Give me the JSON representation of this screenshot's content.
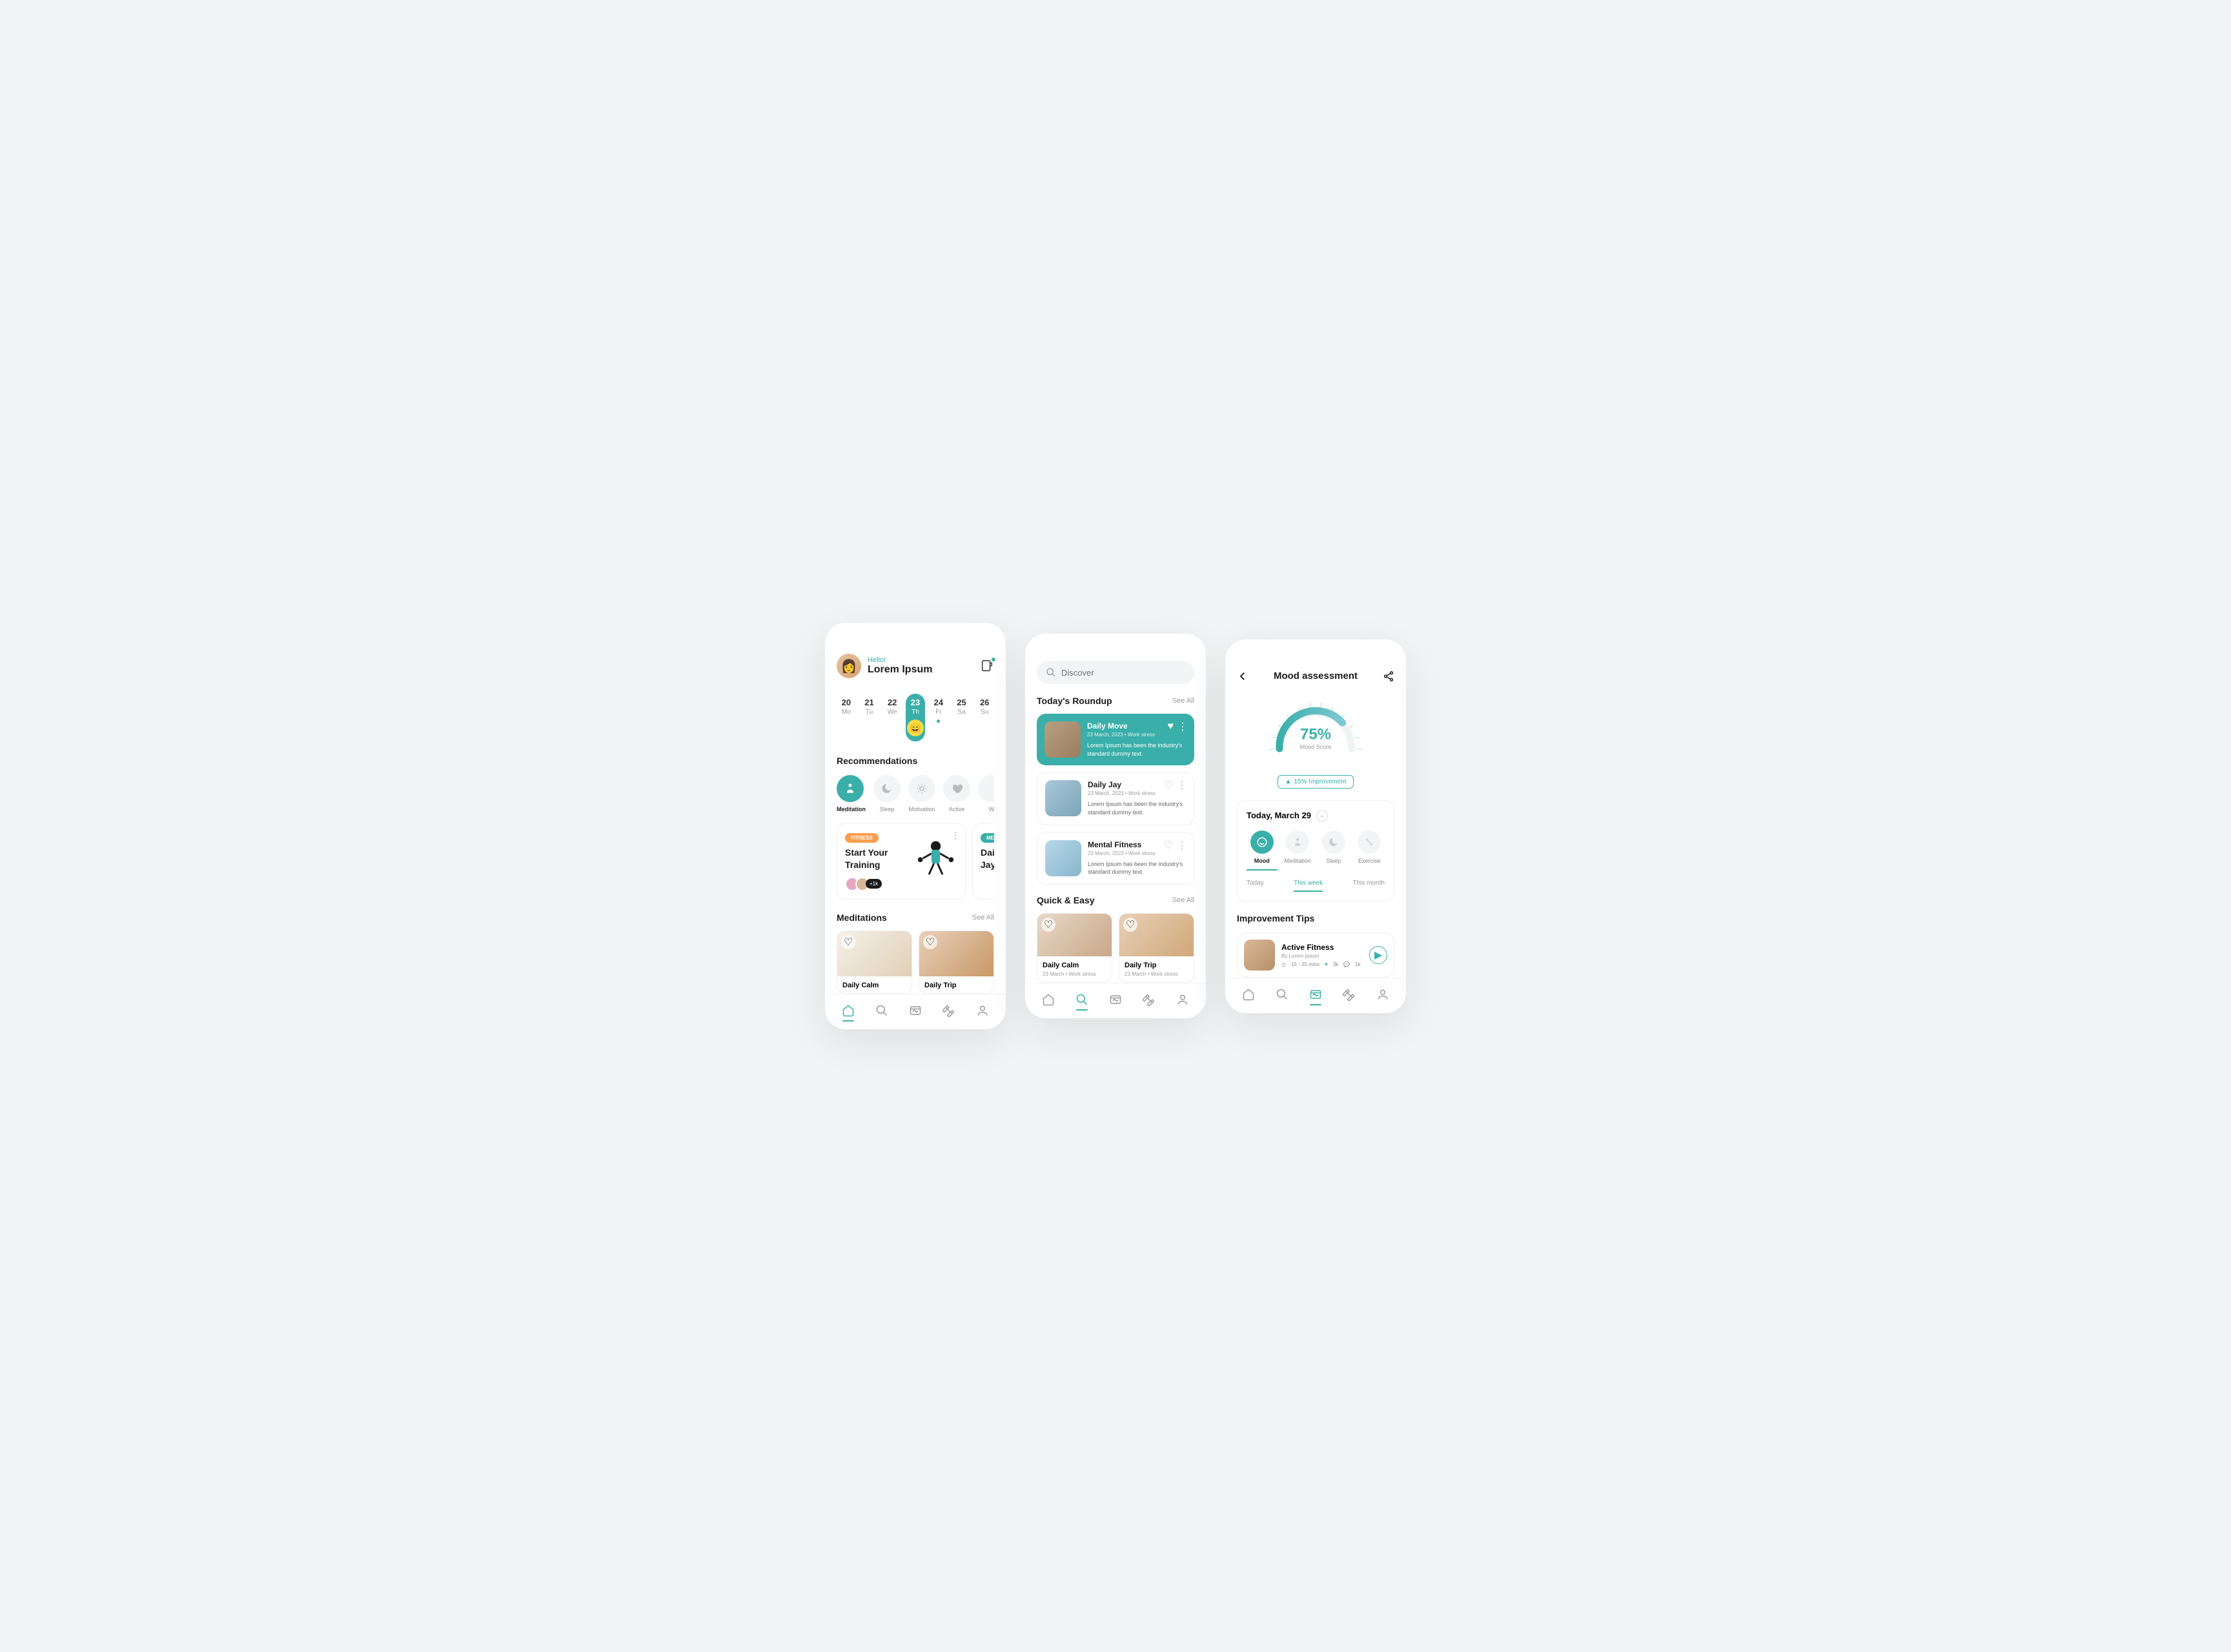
{
  "screen1": {
    "greeting": "Hello!",
    "username": "Lorem Ipsum",
    "dates": [
      {
        "num": "20",
        "day": "Mo"
      },
      {
        "num": "21",
        "day": "Tu"
      },
      {
        "num": "22",
        "day": "We"
      },
      {
        "num": "23",
        "day": "Th",
        "selected": true
      },
      {
        "num": "24",
        "day": "Fr",
        "dot": true
      },
      {
        "num": "25",
        "day": "Sa"
      },
      {
        "num": "26",
        "day": "Su"
      }
    ],
    "recommendations_title": "Recommendations",
    "recs": [
      {
        "label": "Meditation",
        "icon": "meditate"
      },
      {
        "label": "Sleep",
        "icon": "moon"
      },
      {
        "label": "Motivation",
        "icon": "sun"
      },
      {
        "label": "Active",
        "icon": "heart"
      },
      {
        "label": "W",
        "icon": "dot"
      }
    ],
    "cards": [
      {
        "tag": "FITNESS",
        "title": "Start Your Training",
        "count": "+1k"
      },
      {
        "tag": "MEDI",
        "title": "Daily Jay"
      }
    ],
    "meditations_title": "Meditations",
    "see_all": "See All",
    "meds": [
      {
        "title": "Daily Calm"
      },
      {
        "title": "Daily Trip"
      }
    ]
  },
  "screen2": {
    "search_placeholder": "Discover",
    "roundup_title": "Today's Roundup",
    "see_all": "See All",
    "roundup": [
      {
        "title": "Daily Move",
        "date": "23 March, 2023",
        "tag": "Work stress",
        "desc": "Lorem Ipsum has been the industry's standard dummy text."
      },
      {
        "title": "Daily Jay",
        "date": "23 March, 2023",
        "tag": "Work stress",
        "desc": "Lorem Ipsum has been the industry's standard dummy text."
      },
      {
        "title": "Mental Fitness",
        "date": "23 March, 2023",
        "tag": "Work stress",
        "desc": "Lorem Ipsum has been the industry's standard dummy text."
      }
    ],
    "quickeasy_title": "Quick & Easy",
    "quickeasy": [
      {
        "title": "Daily Calm",
        "date": "23 March",
        "tag": "Work stress"
      },
      {
        "title": "Daily Trip",
        "date": "23 March",
        "tag": "Work stress"
      }
    ]
  },
  "screen3": {
    "title": "Mood assessment",
    "score_pct": "75%",
    "score_label": "Mood Score",
    "improvement": "15% Improvement",
    "date": "Today, March 29",
    "categories": [
      {
        "label": "Mood"
      },
      {
        "label": "Meditation"
      },
      {
        "label": "Sleep"
      },
      {
        "label": "Exercise"
      }
    ],
    "tabs": [
      {
        "label": "Today"
      },
      {
        "label": "This week"
      },
      {
        "label": "This month"
      }
    ],
    "tips_title": "Improvement Tips",
    "tip": {
      "title": "Active Fitness",
      "author": "By Lorem Ipsum",
      "duration": "15 - 25 mins",
      "likes": "3k",
      "comments": "1k"
    }
  },
  "chart_data": {
    "type": "gauge",
    "value": 75,
    "min": 0,
    "max": 100,
    "label": "Mood Score",
    "unit": "%",
    "delta": 15,
    "delta_label": "Improvement"
  }
}
